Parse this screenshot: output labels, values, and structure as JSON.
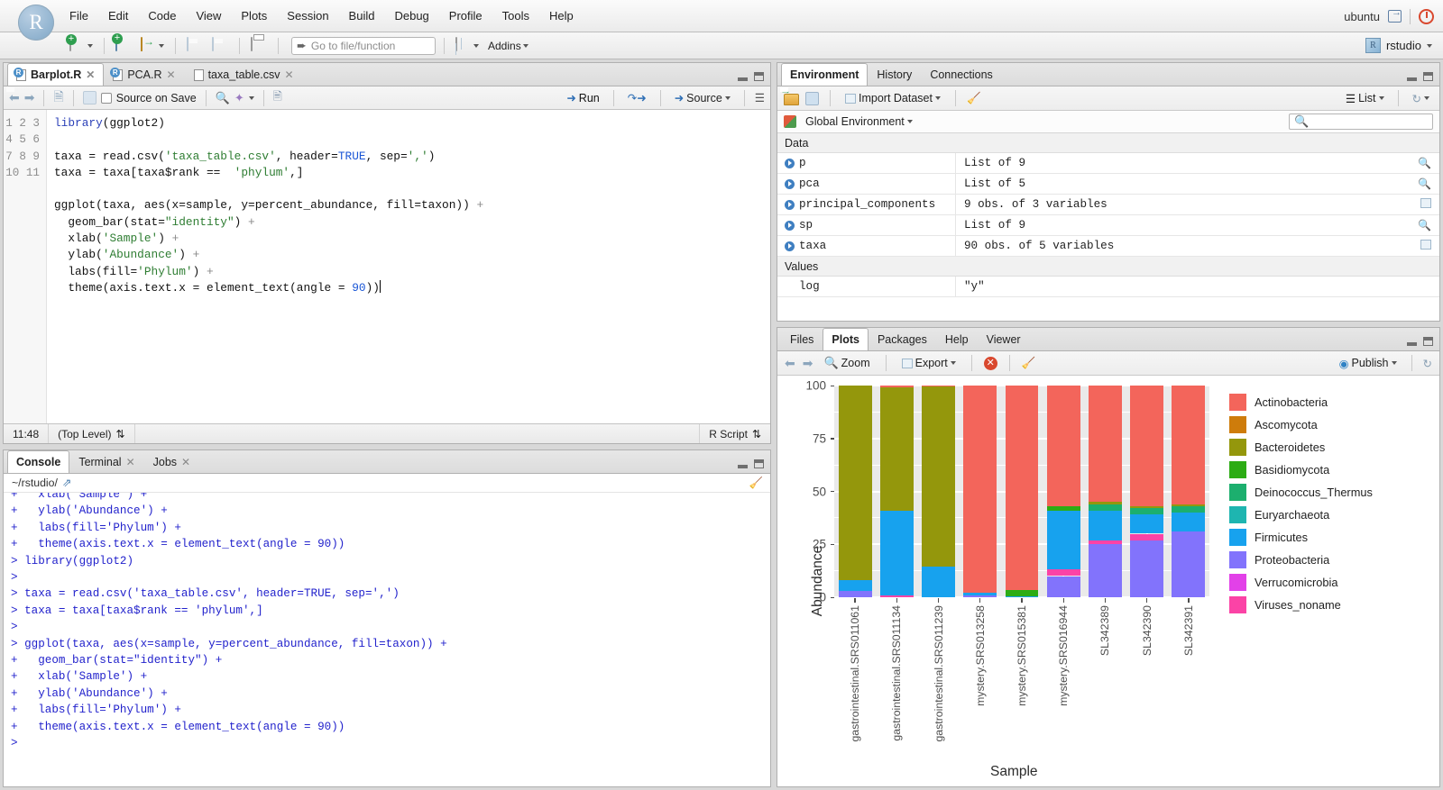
{
  "app": {
    "menu": [
      "File",
      "Edit",
      "Code",
      "View",
      "Plots",
      "Session",
      "Build",
      "Debug",
      "Profile",
      "Tools",
      "Help"
    ],
    "user": "ubuntu",
    "project": "rstudio",
    "logo": "R"
  },
  "toolbar": {
    "goto_placeholder": "Go to file/function",
    "addins_label": "Addins"
  },
  "source": {
    "tabs": [
      {
        "label": "Barplot.R",
        "icon": "r-script-icon",
        "active": true,
        "closeable": true
      },
      {
        "label": "PCA.R",
        "icon": "r-script-icon",
        "active": false,
        "closeable": true
      },
      {
        "label": "taxa_table.csv",
        "icon": "csv-file-icon",
        "active": false,
        "closeable": true
      }
    ],
    "toolbar": {
      "source_on_save": "Source on Save",
      "run": "Run",
      "source": "Source"
    },
    "line_numbers": [
      "1",
      "2",
      "3",
      "4",
      "5",
      "6",
      "7",
      "8",
      "9",
      "10",
      "11"
    ],
    "lines": [
      "library(ggplot2)",
      "",
      "taxa = read.csv('taxa_table.csv', header=TRUE, sep=',')",
      "taxa = taxa[taxa$rank == 'phylum',]",
      "",
      "ggplot(taxa, aes(x=sample, y=percent_abundance, fill=taxon)) +",
      "  geom_bar(stat=\"identity\") +",
      "  xlab('Sample') +",
      "  ylab('Abundance') +",
      "  labs(fill='Phylum') +",
      "  theme(axis.text.x = element_text(angle = 90))"
    ],
    "status": {
      "cursor": "11:48",
      "scope": "(Top Level)",
      "filetype": "R Script"
    }
  },
  "console": {
    "tabs": [
      {
        "label": "Console",
        "active": true,
        "closeable": false
      },
      {
        "label": "Terminal",
        "active": false,
        "closeable": true
      },
      {
        "label": "Jobs",
        "active": false,
        "closeable": true
      }
    ],
    "path": "~/rstudio/",
    "lines": [
      "+   xlab('Sample') +",
      "+   ylab('Abundance') +",
      "+   labs(fill='Phylum') +",
      "+   theme(axis.text.x = element_text(angle = 90))",
      "> library(ggplot2)",
      ">",
      "> taxa = read.csv('taxa_table.csv', header=TRUE, sep=',')",
      "> taxa = taxa[taxa$rank == 'phylum',]",
      ">",
      "> ggplot(taxa, aes(x=sample, y=percent_abundance, fill=taxon)) +",
      "+   geom_bar(stat=\"identity\") +",
      "+   xlab('Sample') +",
      "+   ylab('Abundance') +",
      "+   labs(fill='Phylum') +",
      "+   theme(axis.text.x = element_text(angle = 90))",
      "> "
    ]
  },
  "environment": {
    "tabs": [
      {
        "label": "Environment",
        "active": true
      },
      {
        "label": "History",
        "active": false
      },
      {
        "label": "Connections",
        "active": false
      }
    ],
    "toolbar": {
      "import_dataset": "Import Dataset",
      "view_mode": "List"
    },
    "scope": "Global Environment",
    "search_placeholder": "",
    "sections": [
      {
        "title": "Data",
        "rows": [
          {
            "name": "p",
            "value": "List of 9",
            "action": "inspect-icon"
          },
          {
            "name": "pca",
            "value": "List of 5",
            "action": "inspect-icon"
          },
          {
            "name": "principal_components",
            "value": "9 obs. of 3 variables",
            "action": "grid-icon"
          },
          {
            "name": "sp",
            "value": "List of 9",
            "action": "inspect-icon"
          },
          {
            "name": "taxa",
            "value": "90 obs. of 5 variables",
            "action": "grid-icon"
          }
        ]
      },
      {
        "title": "Values",
        "rows": [
          {
            "name": "log",
            "value": "\"y\"",
            "action": ""
          }
        ]
      }
    ]
  },
  "plots": {
    "tabs": [
      {
        "label": "Files",
        "active": false
      },
      {
        "label": "Plots",
        "active": true
      },
      {
        "label": "Packages",
        "active": false
      },
      {
        "label": "Help",
        "active": false
      },
      {
        "label": "Viewer",
        "active": false
      }
    ],
    "toolbar": {
      "zoom": "Zoom",
      "export": "Export",
      "publish": "Publish"
    }
  },
  "chart_data": {
    "type": "bar",
    "subtype": "stacked",
    "title": "",
    "xlabel": "Sample",
    "ylabel": "Abundance",
    "ylim": [
      0,
      100
    ],
    "yticks": [
      0,
      25,
      50,
      75,
      100
    ],
    "grid": true,
    "legend": {
      "title": "Phylum",
      "position": "right",
      "entries": [
        {
          "label": "Actinobacteria",
          "color": "#F3655B"
        },
        {
          "label": "Ascomycota",
          "color": "#CE7C0B"
        },
        {
          "label": "Bacteroidetes",
          "color": "#94970C"
        },
        {
          "label": "Basidiomycota",
          "color": "#2CAC14"
        },
        {
          "label": "Deinococcus_Thermus",
          "color": "#1CAF6E"
        },
        {
          "label": "Euryarchaeota",
          "color": "#1EB5B0"
        },
        {
          "label": "Firmicutes",
          "color": "#17A2EE"
        },
        {
          "label": "Proteobacteria",
          "color": "#8273FC"
        },
        {
          "label": "Verrucomicrobia",
          "color": "#E241E8"
        },
        {
          "label": "Viruses_noname",
          "color": "#FB43A6"
        }
      ]
    },
    "categories": [
      "gastrointestinal.SRS011061",
      "gastrointestinal.SRS011134",
      "gastrointestinal.SRS011239",
      "mystery.SRS013258",
      "mystery.SRS015381",
      "mystery.SRS016944",
      "SL342389",
      "SL342390",
      "SL342391"
    ],
    "series": [
      {
        "name": "Actinobacteria",
        "color": "#F3655B",
        "values": [
          0.0,
          1.0,
          0.5,
          98.0,
          96.5,
          57.0,
          55.0,
          57.0,
          56.0
        ]
      },
      {
        "name": "Ascomycota",
        "color": "#CE7C0B",
        "values": [
          0.0,
          0.0,
          0.0,
          0.0,
          0.0,
          0.0,
          0.0,
          0.0,
          0.0
        ]
      },
      {
        "name": "Bacteroidetes",
        "color": "#94970C",
        "values": [
          92.0,
          58.0,
          85.0,
          0.0,
          0.0,
          0.0,
          1.0,
          1.0,
          1.0
        ]
      },
      {
        "name": "Basidiomycota",
        "color": "#2CAC14",
        "values": [
          0.0,
          0.0,
          0.0,
          0.0,
          3.0,
          2.0,
          0.0,
          0.0,
          0.0
        ]
      },
      {
        "name": "Deinococcus_Thermus",
        "color": "#1CAF6E",
        "values": [
          0.0,
          0.0,
          0.0,
          0.0,
          0.0,
          0.0,
          3.0,
          3.0,
          3.0
        ]
      },
      {
        "name": "Euryarchaeota",
        "color": "#1EB5B0",
        "values": [
          0.0,
          0.0,
          0.0,
          0.0,
          0.0,
          0.0,
          0.0,
          0.0,
          0.0
        ]
      },
      {
        "name": "Firmicutes",
        "color": "#17A2EE",
        "values": [
          5.0,
          40.0,
          14.5,
          1.0,
          0.5,
          28.0,
          14.0,
          9.0,
          9.0
        ]
      },
      {
        "name": "Proteobacteria",
        "color": "#8273FC",
        "values": [
          3.0,
          0.0,
          0.0,
          1.0,
          0.0,
          10.0,
          25.0,
          27.0,
          31.0
        ]
      },
      {
        "name": "Verrucomicrobia",
        "color": "#E241E8",
        "values": [
          0.0,
          0.0,
          0.0,
          0.0,
          0.0,
          0.0,
          0.0,
          0.0,
          0.0
        ]
      },
      {
        "name": "Viruses_noname",
        "color": "#FB43A6",
        "values": [
          0.0,
          1.0,
          0.0,
          0.0,
          0.0,
          3.0,
          2.0,
          3.0,
          0.0
        ]
      }
    ],
    "stack_order": [
      "Proteobacteria",
      "Viruses_noname",
      "Firmicutes",
      "Basidiomycota",
      "Deinococcus_Thermus",
      "Bacteroidetes",
      "Ascomycota",
      "Actinobacteria"
    ]
  }
}
